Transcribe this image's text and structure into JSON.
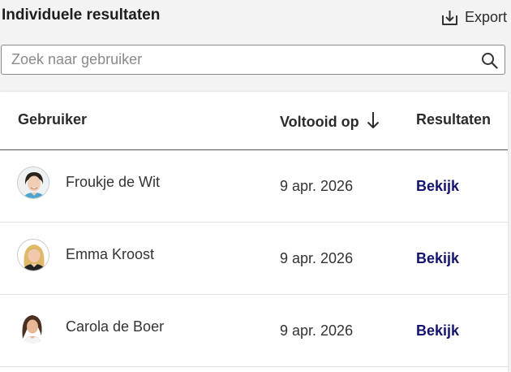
{
  "header": {
    "title": "Individuele resultaten",
    "export_label": "Export",
    "export_icon": "download-icon"
  },
  "search": {
    "placeholder": "Zoek naar gebruiker",
    "value": "",
    "icon": "search-icon"
  },
  "table": {
    "columns": {
      "user": "Gebruiker",
      "completed": "Voltooid op",
      "completed_sort": "descending",
      "results": "Resultaten"
    },
    "rows": [
      {
        "name": "Froukje de Wit",
        "date": "9 apr. 2026",
        "action": "Bekijk"
      },
      {
        "name": "Emma Kroost",
        "date": "9 apr. 2026",
        "action": "Bekijk"
      },
      {
        "name": "Carola de Boer",
        "date": "9 apr. 2026",
        "action": "Bekijk"
      }
    ]
  },
  "colors": {
    "background": "#f3f3f3",
    "card": "#ffffff",
    "link": "#141470",
    "text": "#2b2b2b"
  }
}
